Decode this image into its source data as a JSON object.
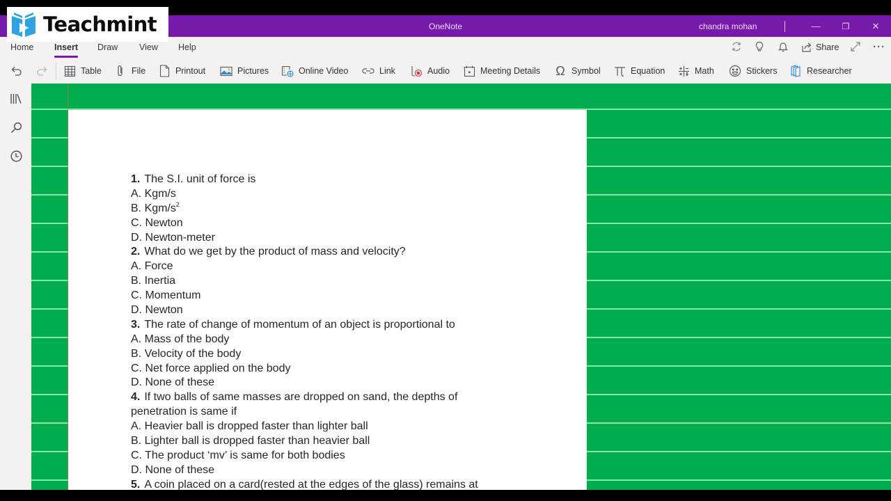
{
  "watermark": {
    "brand": "Teachmint"
  },
  "titlebar": {
    "app_title": "OneNote",
    "user_name": "chandra mohan",
    "minimize_glyph": "—",
    "restore_glyph": "❐",
    "close_glyph": "✕"
  },
  "ribbon": {
    "tabs": [
      {
        "label": "Home"
      },
      {
        "label": "Insert",
        "active": true
      },
      {
        "label": "Draw"
      },
      {
        "label": "View"
      },
      {
        "label": "Help"
      }
    ],
    "right_actions": {
      "sync_icon": "sync-icon",
      "tell_me_icon": "lightbulb-icon",
      "notifications_icon": "bell-icon",
      "share_label": "Share",
      "fullscreen_icon": "expand-icon",
      "more_icon": "more-icon"
    },
    "toolbar": {
      "undo_icon": "undo-icon",
      "redo_icon": "redo-icon",
      "items": [
        {
          "label": "Table",
          "icon": "table-icon"
        },
        {
          "label": "File",
          "icon": "paperclip-icon"
        },
        {
          "label": "Printout",
          "icon": "document-icon"
        },
        {
          "label": "Pictures",
          "icon": "picture-icon"
        },
        {
          "label": "Online Video",
          "icon": "online-video-icon"
        },
        {
          "label": "Link",
          "icon": "link-icon"
        },
        {
          "label": "Audio",
          "icon": "audio-record-icon"
        },
        {
          "label": "Meeting Details",
          "icon": "calendar-icon"
        },
        {
          "label": "Symbol",
          "icon": "omega-icon"
        },
        {
          "label": "Equation",
          "icon": "pi-icon"
        },
        {
          "label": "Math",
          "icon": "math-icon"
        },
        {
          "label": "Stickers",
          "icon": "smiley-icon"
        },
        {
          "label": "Researcher",
          "icon": "researcher-icon"
        }
      ]
    }
  },
  "leftnav": {
    "items": [
      {
        "icon": "notebooks-icon"
      },
      {
        "icon": "search-icon"
      },
      {
        "icon": "recent-icon"
      }
    ]
  },
  "colors": {
    "titlebar": "#7719aa",
    "page_background": "#00ad4e",
    "rule_line": "#9ff0c0",
    "accent": "#7719aa"
  },
  "page": {
    "questions": [
      {
        "number": "1.",
        "text": "The S.I. unit of force is",
        "options": [
          {
            "text": "A. Kgm/s"
          },
          {
            "text": "B. Kgm/s",
            "sup": "2"
          },
          {
            "text": "C. Newton"
          },
          {
            "text": "D. Newton-meter"
          }
        ]
      },
      {
        "number": "2.",
        "text": "What do we get by the product of mass and velocity?",
        "options": [
          {
            "text": "A. Force"
          },
          {
            "text": "B. Inertia"
          },
          {
            "text": "C. Momentum"
          },
          {
            "text": "D. Newton"
          }
        ]
      },
      {
        "number": "3.",
        "text": "The rate of change of momentum of an object is proportional to",
        "options": [
          {
            "text": "A. Mass of the body"
          },
          {
            "text": "B. Velocity of the body"
          },
          {
            "text": "C. Net force applied on the body"
          },
          {
            "text": "D. None of these"
          }
        ]
      },
      {
        "number": "4.",
        "text": "If two balls of same masses are dropped on sand, the depths of",
        "text_cont": "penetration is same if",
        "options": [
          {
            "text": "A. Heavier ball is dropped faster than lighter ball"
          },
          {
            "text": "B. Lighter ball is dropped faster than heavier ball"
          },
          {
            "text": "C. The product ‘mv’ is same for both bodies"
          },
          {
            "text": "D. None of these"
          }
        ]
      },
      {
        "number": "5.",
        "text": "A coin placed on a card(rested at the edges of the glass) remains at"
      }
    ]
  }
}
